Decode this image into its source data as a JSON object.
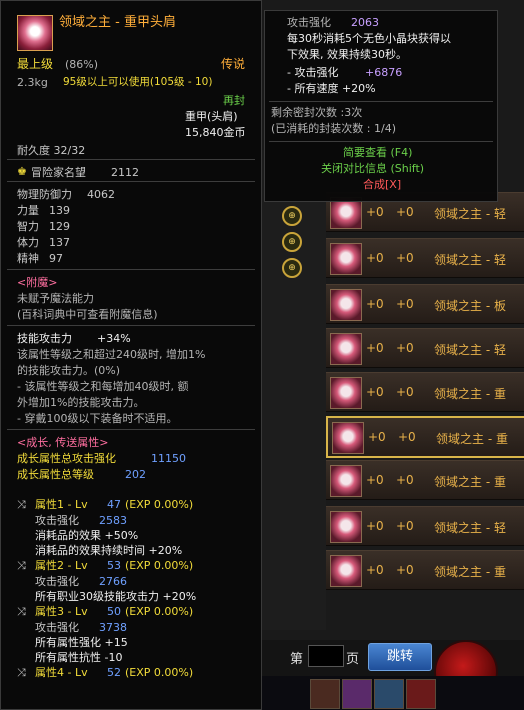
{
  "background": {
    "list_rows": [
      {
        "plus1": "+0",
        "plus2": "+0",
        "name": "领域之主 - 轻"
      },
      {
        "plus1": "+0",
        "plus2": "+0",
        "name": "领域之主 - 轻"
      },
      {
        "plus1": "+0",
        "plus2": "+0",
        "name": "领域之主 - 板"
      },
      {
        "plus1": "+0",
        "plus2": "+0",
        "name": "领域之主 - 轻"
      },
      {
        "plus1": "+0",
        "plus2": "+0",
        "name": "领域之主 - 重"
      },
      {
        "plus1": "+0",
        "plus2": "+0",
        "name": "领域之主 - 重"
      },
      {
        "plus1": "+0",
        "plus2": "+0",
        "name": "领域之主 - 重"
      },
      {
        "plus1": "+0",
        "plus2": "+0",
        "name": "领域之主 - 轻"
      },
      {
        "plus1": "+0",
        "plus2": "+0",
        "name": "领域之主 - 重"
      }
    ],
    "pager": {
      "page_label": "第",
      "page_unit": "页",
      "jump_label": "跳转"
    }
  },
  "tooltip": {
    "item_name": "领域之主 - 重甲头肩",
    "grade": "最上级",
    "grade_pct": "(86%)",
    "rarity": "传说",
    "weight": "2.3kg",
    "level_req": "95级以上可以使用(105级 - 10)",
    "bind": "再封",
    "type": "重甲(头肩)",
    "price": "15,840金币",
    "durability": "耐久度 32/32",
    "adventure_fame_label": "冒险家名望",
    "adventure_fame_value": "2112",
    "stats": [
      {
        "label": "物理防御力",
        "value": "4062"
      },
      {
        "label": "力量",
        "value": "139"
      },
      {
        "label": "智力",
        "value": "129"
      },
      {
        "label": "体力",
        "value": "137"
      },
      {
        "label": "精神",
        "value": "97"
      }
    ],
    "enchant_header": "<附魔>",
    "enchant_line1": "未赋予魔法能力",
    "enchant_line2": "(百科词典中可查看附魔信息)",
    "skill_atk_label": "技能攻击力",
    "skill_atk_value": "+34%",
    "skill_desc": [
      "该属性等级之和超过240级时, 增加1%",
      "的技能攻击力。(0%)",
      "- 该属性等级之和每增加40级时, 额",
      "外增加1%的技能攻击力。",
      "- 穿戴100级以下装备时不适用。"
    ],
    "growth_header": "<成长, 传送属性>",
    "growth_total_atk_label": "成长属性总攻击强化",
    "growth_total_atk_value": "11150",
    "growth_total_lv_label": "成长属性总等级",
    "growth_total_lv_value": "202",
    "props": [
      {
        "title": "属性1 - Lv",
        "lv": "47",
        "exp": "(EXP 0.00%)",
        "lines": [
          {
            "label": "攻击强化",
            "value": "2583",
            "vclass": "c-blue"
          },
          {
            "label": "消耗品的效果 +50%",
            "value": "",
            "vclass": ""
          },
          {
            "label": "消耗品的效果持续时间 +20%",
            "value": "",
            "vclass": ""
          }
        ]
      },
      {
        "title": "属性2 - Lv",
        "lv": "53",
        "exp": "(EXP 0.00%)",
        "lines": [
          {
            "label": "攻击强化",
            "value": "2766",
            "vclass": "c-blue"
          },
          {
            "label": "所有职业30级技能攻击力 +20%",
            "value": "",
            "vclass": ""
          }
        ]
      },
      {
        "title": "属性3 - Lv",
        "lv": "50",
        "exp": "(EXP 0.00%)",
        "lines": [
          {
            "label": "攻击强化",
            "value": "3738",
            "vclass": "c-blue"
          },
          {
            "label": "所有属性强化 +15",
            "value": "",
            "vclass": ""
          },
          {
            "label": "所有属性抗性 -10",
            "value": "",
            "vclass": ""
          }
        ]
      },
      {
        "title": "属性4 - Lv",
        "lv": "52",
        "exp": "(EXP 0.00%)",
        "lines": []
      }
    ]
  },
  "side_tooltip": {
    "atk_label": "攻击强化",
    "atk_value": "2063",
    "desc": [
      "每30秒消耗5个无色小晶块获得以",
      "下效果, 效果持续30秒。"
    ],
    "bonus1_label": "- 攻击强化",
    "bonus1_value": "+6876",
    "bonus2": "- 所有速度 +20%",
    "seal_remaining": "剩余密封次数 :3次",
    "seal_used": "(已消耗的封装次数 : 1/4)",
    "view_brief": "简要查看 (F4)",
    "close_compare": "关闭对比信息 (Shift)",
    "compose": "合成[X]"
  }
}
